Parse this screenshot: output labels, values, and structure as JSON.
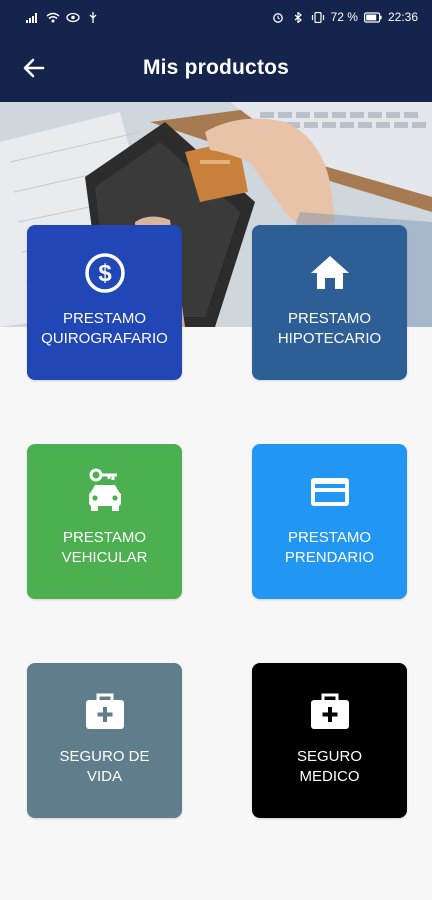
{
  "status_bar": {
    "battery": "72 %",
    "time": "22:36"
  },
  "app_bar": {
    "title": "Mis productos"
  },
  "products": [
    {
      "label": "PRESTAMO\nQUIROGRAFARIO",
      "color": "#2146b5",
      "icon": "dollar-circle-icon"
    },
    {
      "label": "PRESTAMO\nHIPOTECARIO",
      "color": "#2d5f96",
      "icon": "house-icon"
    },
    {
      "label": "PRESTAMO\nVEHICULAR",
      "color": "#4caf50",
      "icon": "car-key-icon"
    },
    {
      "label": "PRESTAMO\nPRENDARIO",
      "color": "#2196f3",
      "icon": "credit-card-icon"
    },
    {
      "label": "SEGURO DE\nVIDA",
      "color": "#607d8b",
      "icon": "medical-bag-icon"
    },
    {
      "label": "SEGURO\nMEDICO",
      "color": "#000000",
      "icon": "medical-bag-icon"
    }
  ],
  "theme": {
    "header": "#15244d",
    "background": "#f7f7f7"
  }
}
